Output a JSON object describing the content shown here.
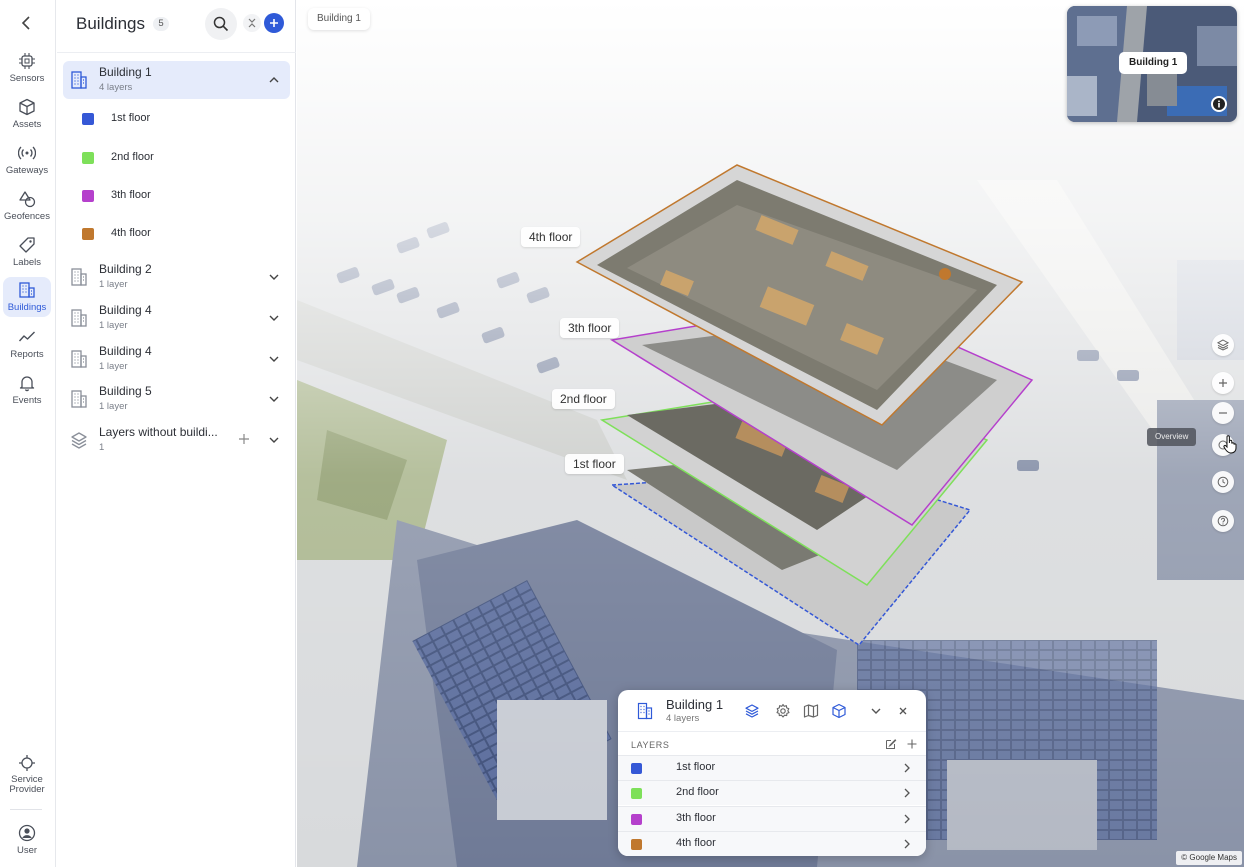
{
  "nav": {
    "items": [
      {
        "key": "sensors",
        "label": "Sensors",
        "icon": "chip-icon"
      },
      {
        "key": "assets",
        "label": "Assets",
        "icon": "cube-icon"
      },
      {
        "key": "gateways",
        "label": "Gateways",
        "icon": "antenna-icon"
      },
      {
        "key": "geofences",
        "label": "Geofences",
        "icon": "shapes-icon"
      },
      {
        "key": "labels",
        "label": "Labels",
        "icon": "tag-icon"
      },
      {
        "key": "buildings",
        "label": "Buildings",
        "icon": "building-icon",
        "active": true
      },
      {
        "key": "reports",
        "label": "Reports",
        "icon": "line-chart-icon"
      },
      {
        "key": "events",
        "label": "Events",
        "icon": "bell-icon"
      }
    ],
    "service_provider": "Service Provider",
    "user": "User"
  },
  "panel": {
    "title": "Buildings",
    "count": "5",
    "buildings": [
      {
        "name": "Building 1",
        "sub": "4 layers",
        "expanded": true
      },
      {
        "name": "Building 2",
        "sub": "1 layer"
      },
      {
        "name": "Building 4",
        "sub": "1 layer"
      },
      {
        "name": "Building 4",
        "sub": "1 layer"
      },
      {
        "name": "Building 5",
        "sub": "1 layer"
      },
      {
        "name": "Layers without buildi...",
        "sub": "1"
      }
    ],
    "floors": [
      {
        "name": "1st floor",
        "color": "#3558d6"
      },
      {
        "name": "2nd floor",
        "color": "#7ee05a"
      },
      {
        "name": "3th floor",
        "color": "#b540cc"
      },
      {
        "name": "4th floor",
        "color": "#c0782e"
      }
    ]
  },
  "map": {
    "breadcrumb": "Building 1",
    "minimap_label": "Building 1",
    "floor_tags": [
      "4th floor",
      "3th floor",
      "2nd floor",
      "1st floor"
    ],
    "tooltip": "Overview",
    "attribution": "© Google Maps"
  },
  "card": {
    "title": "Building 1",
    "sub": "4 layers",
    "section": "LAYERS",
    "layers": [
      {
        "name": "1st floor",
        "color": "#3558d6"
      },
      {
        "name": "2nd floor",
        "color": "#7ee05a"
      },
      {
        "name": "3th floor",
        "color": "#b540cc"
      },
      {
        "name": "4th floor",
        "color": "#c0782e"
      }
    ]
  }
}
